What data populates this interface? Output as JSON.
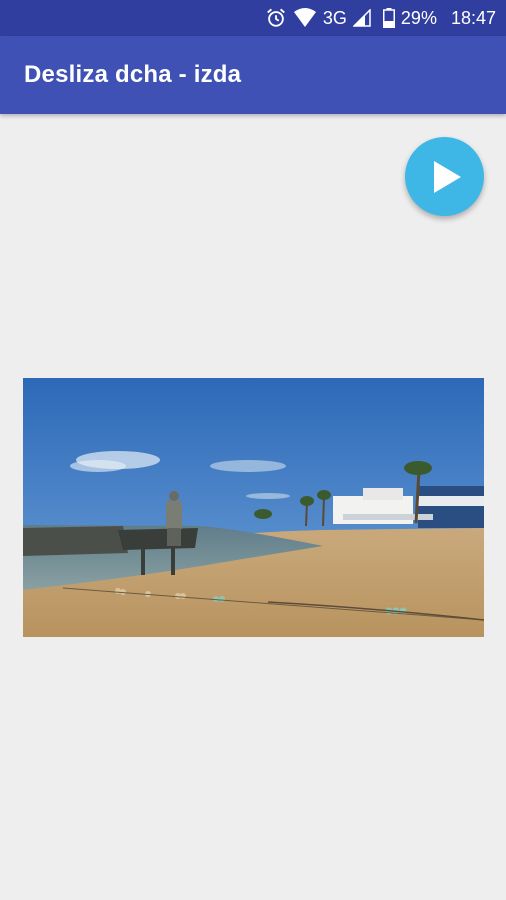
{
  "status_bar": {
    "network": "3G",
    "battery": "29%",
    "time": "18:47",
    "icons": [
      "alarm-icon",
      "wifi-icon",
      "signal-icon",
      "battery-icon"
    ]
  },
  "app_bar": {
    "title": "Desliza dcha - izda",
    "color": "#3f51b5",
    "status_color": "#303f9f"
  },
  "fab": {
    "icon": "play-icon",
    "color": "#3fb7e6"
  },
  "image": {
    "description_icon": "beach-photo"
  }
}
